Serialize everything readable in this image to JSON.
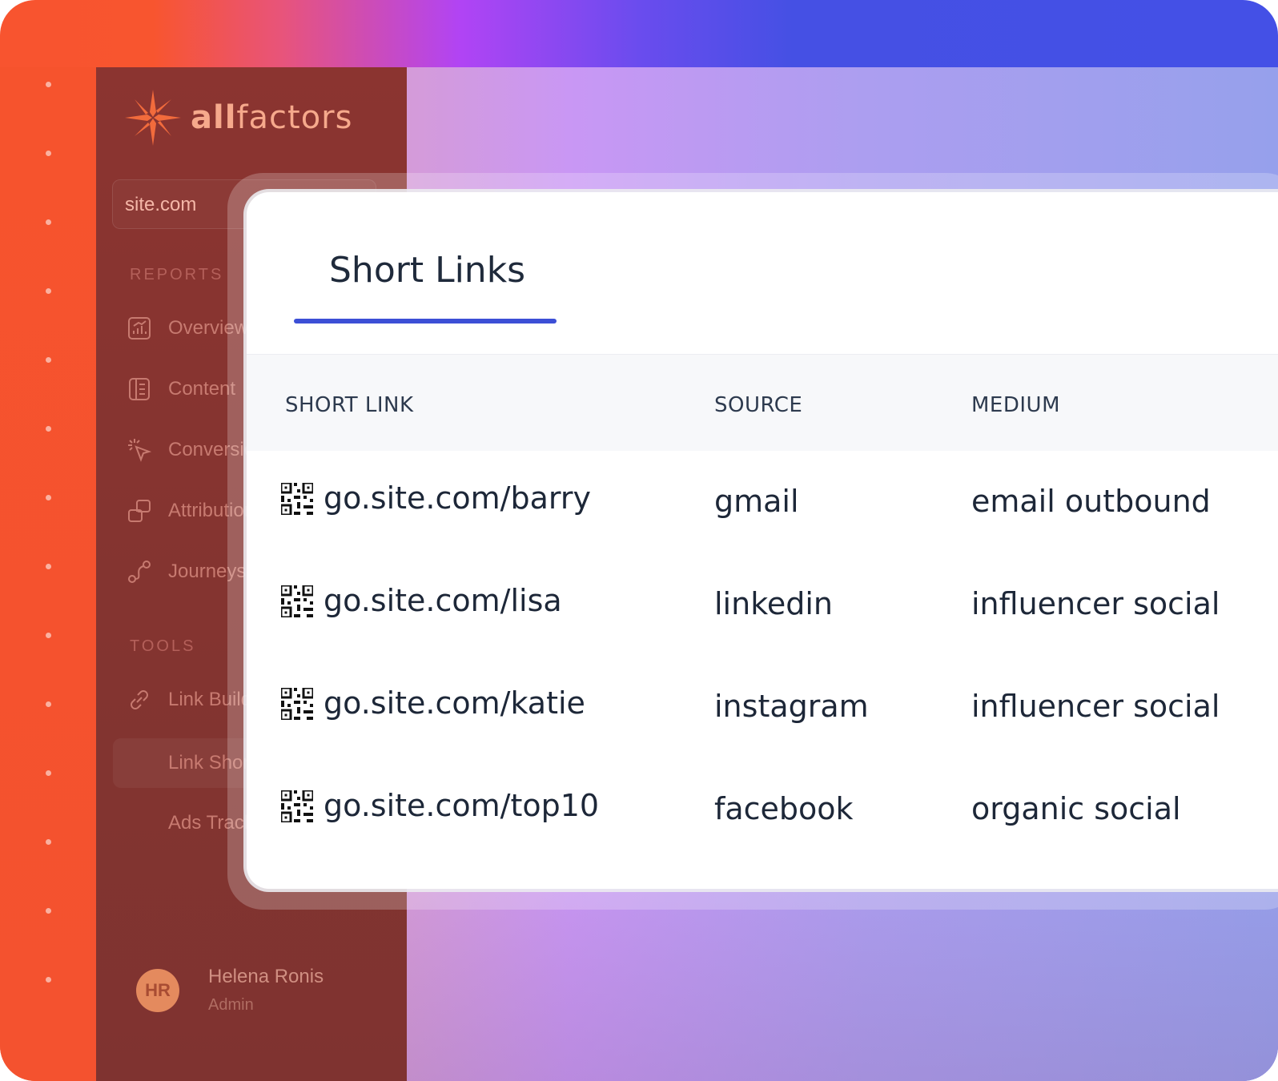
{
  "brand": {
    "name_bold": "all",
    "name_rest": "factors"
  },
  "site_selector": {
    "value": "site.com"
  },
  "sidebar": {
    "reports_label": "REPORTS",
    "tools_label": "TOOLS",
    "reports_items": [
      {
        "label": "Overview",
        "icon": "chart-icon"
      },
      {
        "label": "Content",
        "icon": "document-icon"
      },
      {
        "label": "Conversions",
        "icon": "cursor-click-icon"
      },
      {
        "label": "Attribution",
        "icon": "layers-icon"
      },
      {
        "label": "Journeys",
        "icon": "route-icon"
      }
    ],
    "tools_items": [
      {
        "label": "Link Builder",
        "icon": "link-icon"
      },
      {
        "label": "Link Shortener",
        "icon": ""
      },
      {
        "label": "Ads Tracking",
        "icon": ""
      }
    ]
  },
  "user": {
    "initials": "HR",
    "name": "Helena Ronis",
    "role": "Admin"
  },
  "main": {
    "tab_title": "Short Links",
    "columns": [
      "SHORT LINK",
      "SOURCE",
      "MEDIUM"
    ],
    "rows": [
      {
        "link": "go.site.com/barry",
        "source": "gmail",
        "medium": "email outbound"
      },
      {
        "link": "go.site.com/lisa",
        "source": "linkedin",
        "medium": "influencer social"
      },
      {
        "link": "go.site.com/katie",
        "source": "instagram",
        "medium": "influencer social"
      },
      {
        "link": "go.site.com/top10",
        "source": "facebook",
        "medium": "organic social"
      }
    ]
  },
  "colors": {
    "accent": "#3c4fd6",
    "sidebar": "#8b3430",
    "brand": "#f6a98c"
  }
}
